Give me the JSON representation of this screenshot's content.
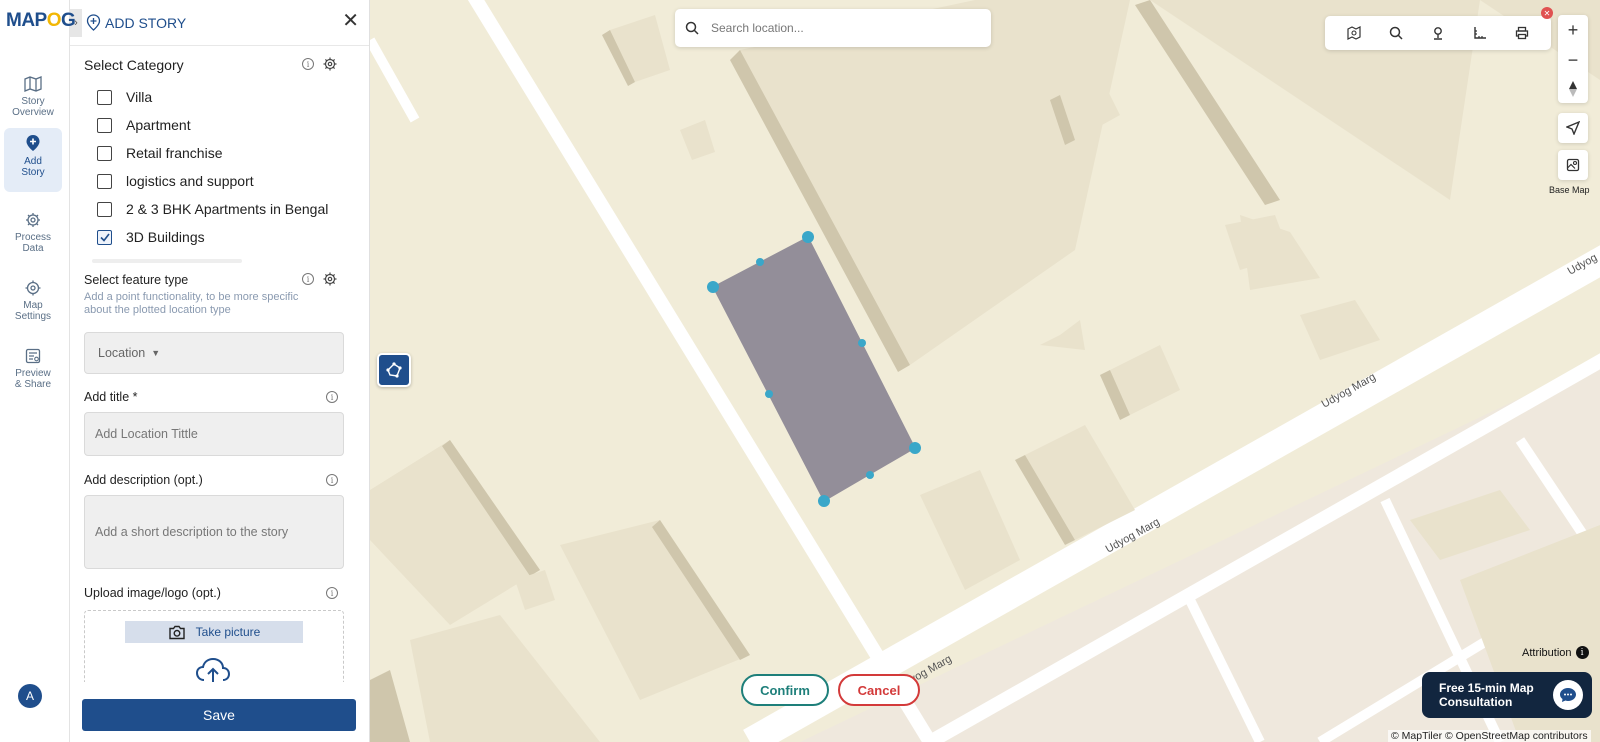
{
  "brand": {
    "logo_prefix": "MAP",
    "logo_mid": "O",
    "logo_suffix": "G"
  },
  "nav": {
    "items": [
      {
        "label": "Story Overview",
        "line1": "Story",
        "line2": "Overview",
        "icon": "map-icon"
      },
      {
        "label": "Add Story",
        "line1": "Add",
        "line2": "Story",
        "icon": "pin-plus-icon",
        "active": true
      },
      {
        "label": "Process Data",
        "line1": "Process",
        "line2": "Data",
        "icon": "gear-icon"
      },
      {
        "label": "Map Settings",
        "line1": "Map",
        "line2": "Settings",
        "icon": "settings-icon"
      },
      {
        "label": "Preview & Share",
        "line1": "Preview",
        "line2": "& Share",
        "icon": "preview-icon"
      }
    ],
    "avatar": "A"
  },
  "panel": {
    "title": "ADD STORY",
    "category_label": "Select Category",
    "categories": [
      {
        "label": "Villa",
        "checked": false
      },
      {
        "label": "Apartment",
        "checked": false
      },
      {
        "label": "Retail franchise",
        "checked": false
      },
      {
        "label": "logistics and support",
        "checked": false
      },
      {
        "label": "2 & 3 BHK Apartments in Bengal",
        "checked": false
      },
      {
        "label": "3D Buildings",
        "checked": true
      }
    ],
    "feature_label": "Select feature type",
    "feature_hint": "Add a point functionality, to be more specific about the plotted location type",
    "feature_value": "Location",
    "title_label": "Add title *",
    "title_placeholder": "Add Location Tittle",
    "desc_label": "Add description (opt.)",
    "desc_placeholder": "Add a short description to the story",
    "upload_label": "Upload image/logo (opt.)",
    "take_picture": "Take picture",
    "save": "Save"
  },
  "map": {
    "search_placeholder": "Search location...",
    "basemap_label": "Base Map",
    "confirm": "Confirm",
    "cancel": "Cancel",
    "attribution": "Attribution",
    "consult_line1": "Free 15-min Map",
    "consult_line2": "Consultation",
    "copyright": "© MapTiler © OpenStreetMap contributors",
    "road_names": [
      "Udyog Marg",
      "Udyog Marg",
      "Udyog Marg",
      "Udyog"
    ],
    "colors": {
      "polygon": "#938e99",
      "vertex": "#3aa7c9",
      "accent": "#1f4e8c"
    }
  }
}
